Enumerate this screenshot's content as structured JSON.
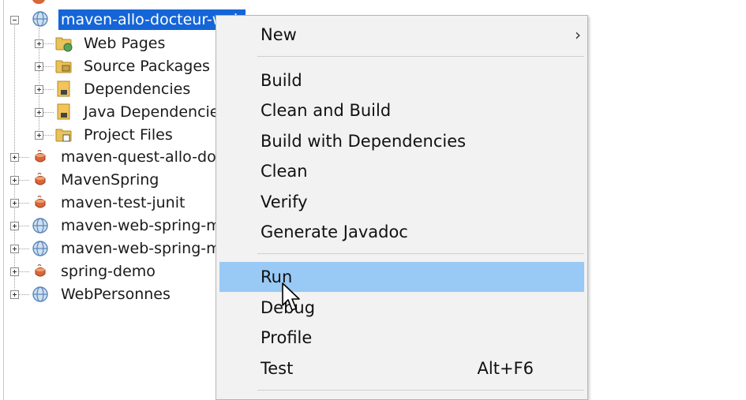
{
  "tree": {
    "root_project": "maven-allo-docteur-web",
    "children": [
      {
        "label": "Web Pages",
        "icon": "folder-web-icon"
      },
      {
        "label": "Source Packages",
        "icon": "folder-source-packages-icon"
      },
      {
        "label": "Dependencies",
        "icon": "folder-dependencies-icon"
      },
      {
        "label": "Java Dependencies",
        "icon": "folder-java-dependencies-icon"
      },
      {
        "label": "Project Files",
        "icon": "folder-project-files-icon"
      }
    ],
    "projects": [
      {
        "label": "maven-quest-allo-docteur",
        "icon": "maven-project-icon"
      },
      {
        "label": "MavenSpring",
        "icon": "maven-project-icon"
      },
      {
        "label": "maven-test-junit",
        "icon": "maven-project-icon"
      },
      {
        "label": "maven-web-spring-mvc",
        "icon": "web-project-icon"
      },
      {
        "label": "maven-web-spring-mvc",
        "icon": "web-project-icon"
      },
      {
        "label": "spring-demo",
        "icon": "maven-project-icon"
      },
      {
        "label": "WebPersonnes",
        "icon": "web-project-icon"
      }
    ]
  },
  "context_menu": {
    "items": [
      {
        "label": "New",
        "submenu": true
      },
      {
        "label": "Build"
      },
      {
        "label": "Clean and Build"
      },
      {
        "label": "Build with Dependencies"
      },
      {
        "label": "Clean"
      },
      {
        "label": "Verify"
      },
      {
        "label": "Generate Javadoc"
      },
      {
        "label": "Run",
        "highlighted": true
      },
      {
        "label": "Debug"
      },
      {
        "label": "Profile"
      },
      {
        "label": "Test",
        "shortcut": "Alt+F6"
      }
    ],
    "submenu_arrow": "›"
  },
  "colors": {
    "selection": "#1565d8",
    "menu_highlight": "#99c9f5",
    "menu_background": "#f2f2f2"
  }
}
